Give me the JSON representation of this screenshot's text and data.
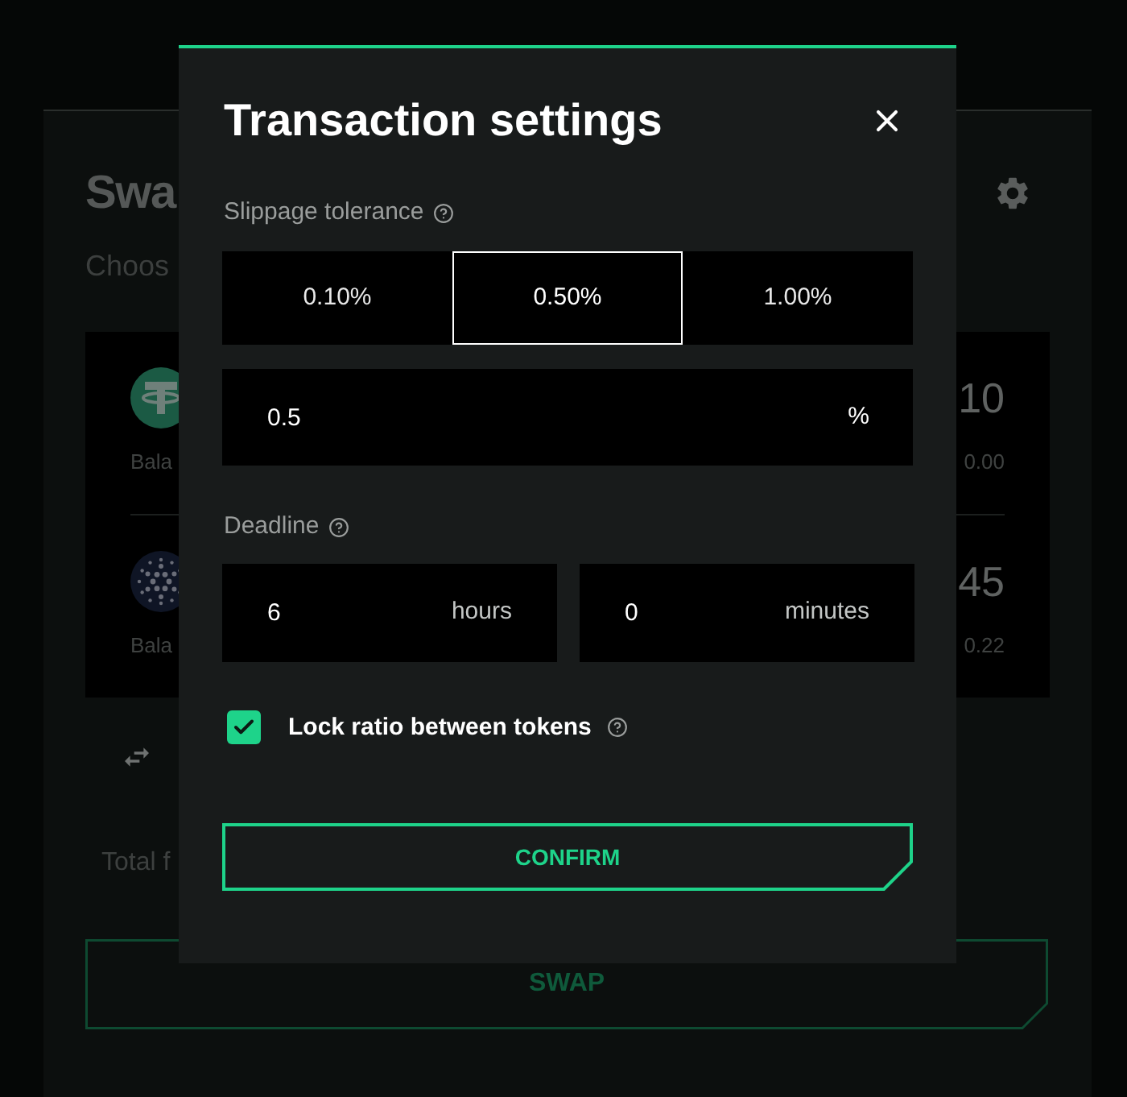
{
  "background": {
    "title": "Swa",
    "subtitle": "Choos",
    "tokens": [
      {
        "balance_label": "Bala",
        "amount": "10",
        "value": "0.00"
      },
      {
        "balance_label": "Bala",
        "amount": "45",
        "value": "0.22"
      }
    ],
    "total_label": "Total f",
    "swap_button": "SWAP"
  },
  "modal": {
    "title": "Transaction settings",
    "slippage": {
      "label": "Slippage tolerance",
      "options": [
        {
          "label": "0.10%",
          "selected": false
        },
        {
          "label": "0.50%",
          "selected": true
        },
        {
          "label": "1.00%",
          "selected": false
        }
      ],
      "input": {
        "value": "0.5",
        "unit": "%"
      }
    },
    "deadline": {
      "label": "Deadline",
      "fields": [
        {
          "value": "6",
          "unit": "hours"
        },
        {
          "value": "0",
          "unit": "minutes"
        }
      ]
    },
    "lock_ratio": {
      "label": "Lock ratio between tokens",
      "checked": true
    },
    "confirm_button": "CONFIRM"
  }
}
